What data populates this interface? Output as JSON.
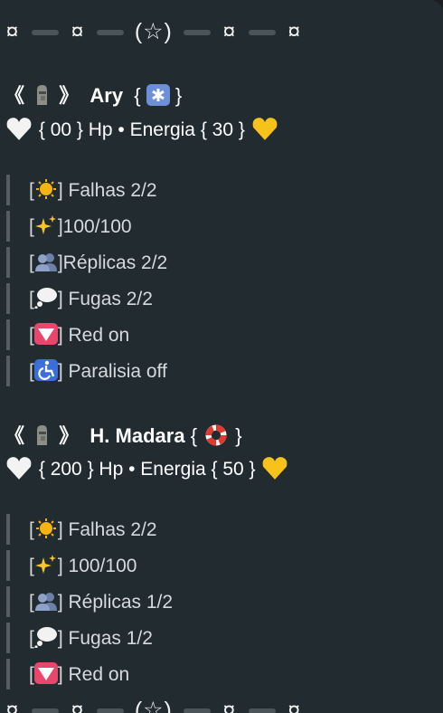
{
  "separator": {
    "glyph": "¤",
    "center": "(☆)"
  },
  "characters": [
    {
      "open": "《",
      "close": "》",
      "name": "Ary",
      "name_brace_open": "{",
      "name_brace_close": "}",
      "hp": "{ 00 } Hp • Energia { 30 }",
      "items": [
        {
          "icon": "sun-icon",
          "text": "] Falhas 2/2"
        },
        {
          "icon": "sparkles-icon",
          "text": "]100/100"
        },
        {
          "icon": "busts-icon",
          "text": "]Réplicas 2/2"
        },
        {
          "icon": "thought-balloon-icon",
          "text": "] Fugas 2/2"
        },
        {
          "icon": "red-triangle-icon",
          "text": "] Red on"
        },
        {
          "icon": "wheelchair-icon",
          "text": "] Paralisia off"
        }
      ]
    },
    {
      "open": "《",
      "close": "》",
      "name": "H. Madara",
      "name_brace_open": "{",
      "name_brace_close": "}",
      "hp": "{ 200 } Hp • Energia { 50 }",
      "items": [
        {
          "icon": "sun-icon",
          "text": "] Falhas 2/2"
        },
        {
          "icon": "sparkles-icon",
          "text": "] 100/100"
        },
        {
          "icon": "busts-icon",
          "text": "] Réplicas 1/2"
        },
        {
          "icon": "thought-balloon-icon",
          "text": "] Fugas 1/2"
        },
        {
          "icon": "red-triangle-icon",
          "text": "] Red on"
        }
      ]
    }
  ],
  "list_bracket": "[",
  "colors": {
    "bubble": "#222b30",
    "bar": "#555d62",
    "item_text": "#d6dadc"
  }
}
